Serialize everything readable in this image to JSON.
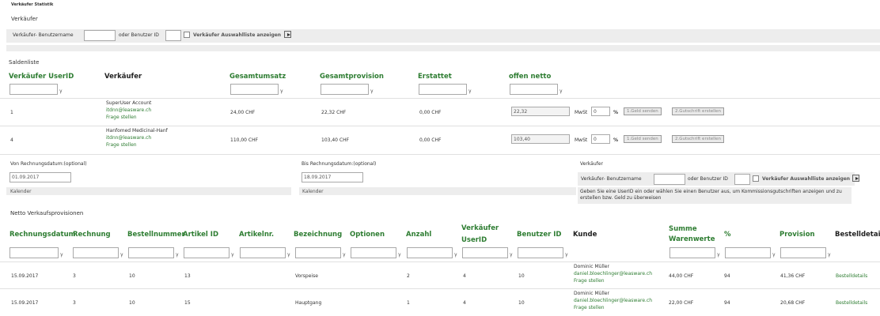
{
  "page_title": "Verkäufer Statistik",
  "seller_filter": {
    "section_label": "Verkäufer",
    "username_label": "Verkäufer- Benutzername",
    "userid_label": "oder Benutzer ID",
    "username_value": "",
    "userid_value": "",
    "selectlist_label": "Verkäufer Auswahlliste anzeigen"
  },
  "saldenliste": {
    "title": "Saldenliste",
    "columns": [
      "Verkäufer UserID",
      "Verkäufer",
      "Gesamtumsatz",
      "Gesamtprovision",
      "Erstattet",
      "offen netto"
    ],
    "rows": [
      {
        "userid": "1",
        "seller_name": "SuperUser Account",
        "seller_email": "itdnn@leasware.ch",
        "seller_link": "Frage stellen",
        "gesamtumsatz": "24,00 CHF",
        "gesamtprovision": "22,32 CHF",
        "erstattet": "0,00 CHF",
        "offen_value": "22,32",
        "mwst_label": "MwSt",
        "mwst_value": "0",
        "percent": "%",
        "btn_send": "1.Geld senden",
        "btn_credit": "2.Gutschrift erstellen"
      },
      {
        "userid": "4",
        "seller_name": "Hanfomed Medicinal-Hanf",
        "seller_email": "itdnn@leasware.ch",
        "seller_link": "Frage stellen",
        "gesamtumsatz": "110,00 CHF",
        "gesamtprovision": "103,40 CHF",
        "erstattet": "0,00 CHF",
        "offen_value": "103,40",
        "mwst_label": "MwSt",
        "mwst_value": "0",
        "percent": "%",
        "btn_send": "1.Geld senden",
        "btn_credit": "2.Gutschrift erstellen"
      }
    ]
  },
  "date_filter": {
    "from_label": "Von Rechnungsdatum:(optional)",
    "from_value": "01.09.2017",
    "to_label": "Bis Rechnungsdatum:(optional)",
    "to_value": "18.09.2017",
    "calendar_label": "Kalender",
    "seller_label": "Verkäufer",
    "username_label": "Verkäufer- Benutzername",
    "userid_label": "oder Benutzer ID",
    "selectlist_label": "Verkäufer Auswahlliste anzeigen",
    "hint": "Geben Sie eine UserID ein oder wählen Sie einen Benutzer aus, um Kommissionsgutschriften anzeigen und zu erstellen bzw. Geld zu überweisen"
  },
  "provisionen": {
    "title": "Netto Verkaufsprovisionen",
    "columns": {
      "rechnungsdatum": "Rechnungsdatum",
      "rechnung": "Rechnung",
      "bestellnummer": "Bestellnummer",
      "artikel_id": "Artikel ID",
      "artikelnr": "Artikelnr.",
      "bezeichnung": "Bezeichnung",
      "optionen": "Optionen",
      "anzahl": "Anzahl",
      "verkaeufer_userid_1": "Verkäufer",
      "verkaeufer_userid_2": "UserID",
      "benutzer_id": "Benutzer ID",
      "kunde": "Kunde",
      "summe_1": "Summe",
      "summe_2": "Warenwerte",
      "percent": "%",
      "provision": "Provision",
      "bestelldetails": "Bestelldetails"
    },
    "rows": [
      {
        "datum": "15.09.2017",
        "rechnung": "3",
        "bestellnummer": "10",
        "artikel_id": "13",
        "artikelnr": "",
        "bezeichnung": "Vorspeise",
        "optionen": "",
        "anzahl": "2",
        "verkaeufer_userid": "4",
        "benutzer_id": "10",
        "kunde_name": "Dominic Müller",
        "kunde_email": "daniel.bloechlinger@leasware.ch",
        "kunde_link": "Frage stellen",
        "summe": "44,00 CHF",
        "percent": "94",
        "provision": "41,36 CHF",
        "details": "Bestelldetails"
      },
      {
        "datum": "15.09.2017",
        "rechnung": "3",
        "bestellnummer": "10",
        "artikel_id": "15",
        "artikelnr": "",
        "bezeichnung": "Hauptgang",
        "optionen": "",
        "anzahl": "1",
        "verkaeufer_userid": "4",
        "benutzer_id": "10",
        "kunde_name": "Dominic Müller",
        "kunde_email": "daniel.bloechlinger@leasware.ch",
        "kunde_link": "Frage stellen",
        "summe": "22,00 CHF",
        "percent": "94",
        "provision": "20,68 CHF",
        "details": "Bestelldetails"
      }
    ]
  }
}
